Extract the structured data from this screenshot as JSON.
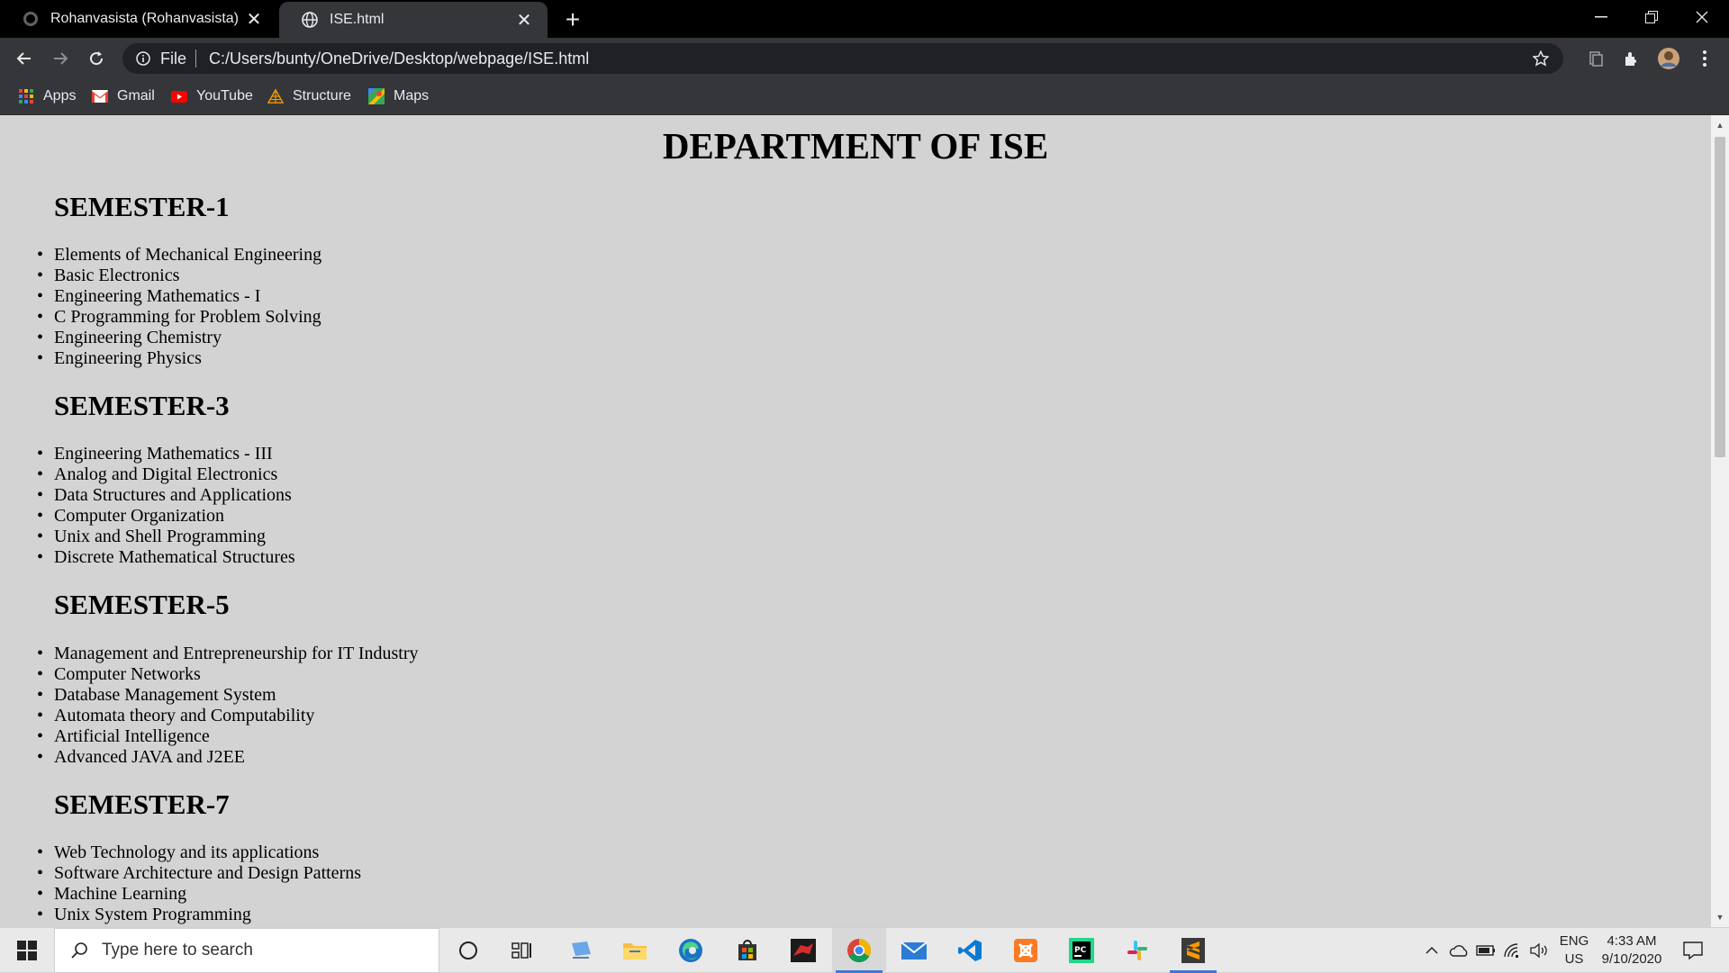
{
  "browser": {
    "tabs": [
      {
        "title": "Rohanvasista (Rohanvasista)",
        "favicon": "github-icon",
        "active": false
      },
      {
        "title": "ISE.html",
        "favicon": "globe-icon",
        "active": true
      }
    ],
    "address": {
      "scheme_label": "File",
      "url": "C:/Users/bunty/OneDrive/Desktop/webpage/ISE.html"
    },
    "bookmarks": [
      {
        "label": "Apps",
        "icon": "apps-grid-icon"
      },
      {
        "label": "Gmail",
        "icon": "gmail-icon"
      },
      {
        "label": "YouTube",
        "icon": "youtube-icon"
      },
      {
        "label": "Structure",
        "icon": "structure-icon"
      },
      {
        "label": "Maps",
        "icon": "maps-icon"
      }
    ],
    "background_color": "#d3d3d3"
  },
  "page": {
    "title": "DEPARTMENT OF ISE",
    "semesters": [
      {
        "heading": "SEMESTER-1",
        "subjects": [
          "Elements of Mechanical Engineering",
          "Basic Electronics",
          "Engineering Mathematics - I",
          "C Programming for Problem Solving",
          "Engineering Chemistry",
          "Engineering Physics"
        ]
      },
      {
        "heading": "SEMESTER-3",
        "subjects": [
          "Engineering Mathematics - III",
          "Analog and Digital Electronics",
          "Data Structures and Applications",
          "Computer Organization",
          "Unix and Shell Programming",
          "Discrete Mathematical Structures"
        ]
      },
      {
        "heading": "SEMESTER-5",
        "subjects": [
          "Management and Entrepreneurship for IT Industry",
          "Computer Networks",
          "Database Management System",
          "Automata theory and Computability",
          "Artificial Intelligence",
          "Advanced JAVA and J2EE"
        ]
      },
      {
        "heading": "SEMESTER-7",
        "subjects": [
          "Web Technology and its applications",
          "Software Architecture and Design Patterns",
          "Machine Learning",
          "Unix System Programming"
        ]
      }
    ]
  },
  "taskbar": {
    "search_placeholder": "Type here to search",
    "apps": [
      "cortana-icon",
      "task-view-icon",
      "pc-icon",
      "file-explorer-icon",
      "edge-icon",
      "store-icon",
      "game-icon",
      "chrome-icon",
      "mail-icon",
      "vscode-icon",
      "xampp-icon",
      "pycharm-icon",
      "slack-icon",
      "sublime-icon"
    ],
    "language": {
      "lang": "ENG",
      "region": "US"
    },
    "clock": {
      "time": "4:33 AM",
      "date": "9/10/2020"
    }
  }
}
